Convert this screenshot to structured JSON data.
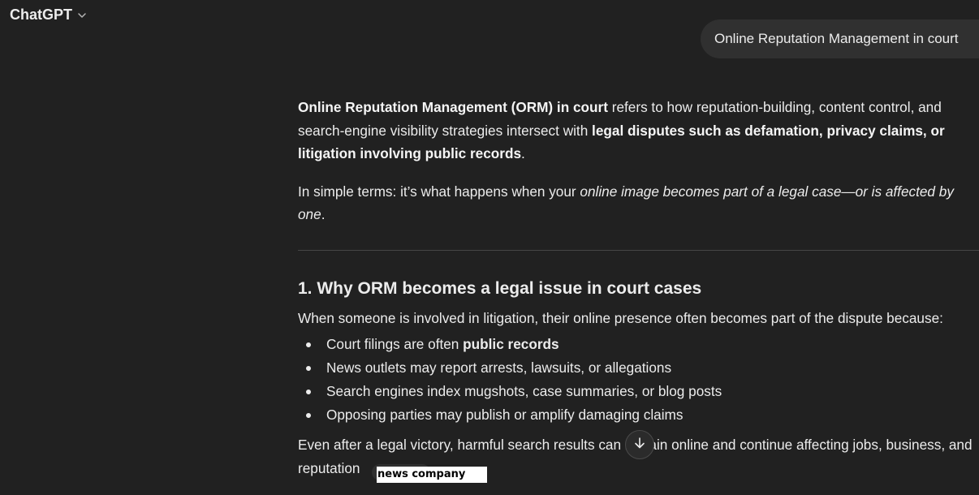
{
  "header": {
    "model_name": "ChatGPT",
    "icons": {
      "model_menu": "chevron-down-icon"
    }
  },
  "user_message": {
    "text": "Online Reputation Management in court"
  },
  "response": {
    "p1": {
      "b1": "Online Reputation Management (ORM) in court",
      "t1": " refers to how reputation-building, content control, and search-engine visibility strategies intersect with ",
      "b2": "legal disputes such as defamation, privacy claims, or litigation involving public records",
      "t2": "."
    },
    "p2": {
      "t1": "In simple terms: it’s what happens when your ",
      "i1": "online image becomes part of a legal case—or is affected by one",
      "t2": "."
    }
  },
  "section1": {
    "title": "1. Why ORM becomes a legal issue in court cases",
    "intro": "When someone is involved in litigation, their online presence often becomes part of the dispute because:",
    "bullets": [
      {
        "text": "Court filings are often ",
        "bold": "public records"
      },
      {
        "text": "News outlets may report arrests, lawsuits, or allegations"
      },
      {
        "text": "Search engines index mugshots, case summaries, or blog posts"
      },
      {
        "text": "Opposing parties may publish or amplify damaging claims"
      }
    ],
    "closing": {
      "line1": "Even after a legal victory, harmful search results can remain online and continue affecting jobs, business, and",
      "line2": "reputation"
    }
  },
  "scroll_button": {
    "icon": "arrow-down-icon"
  },
  "overlay_label": {
    "text": "news company"
  },
  "colors": {
    "background": "#212121",
    "bubble": "#303030",
    "text": "#ececec",
    "divider": "#454545"
  }
}
